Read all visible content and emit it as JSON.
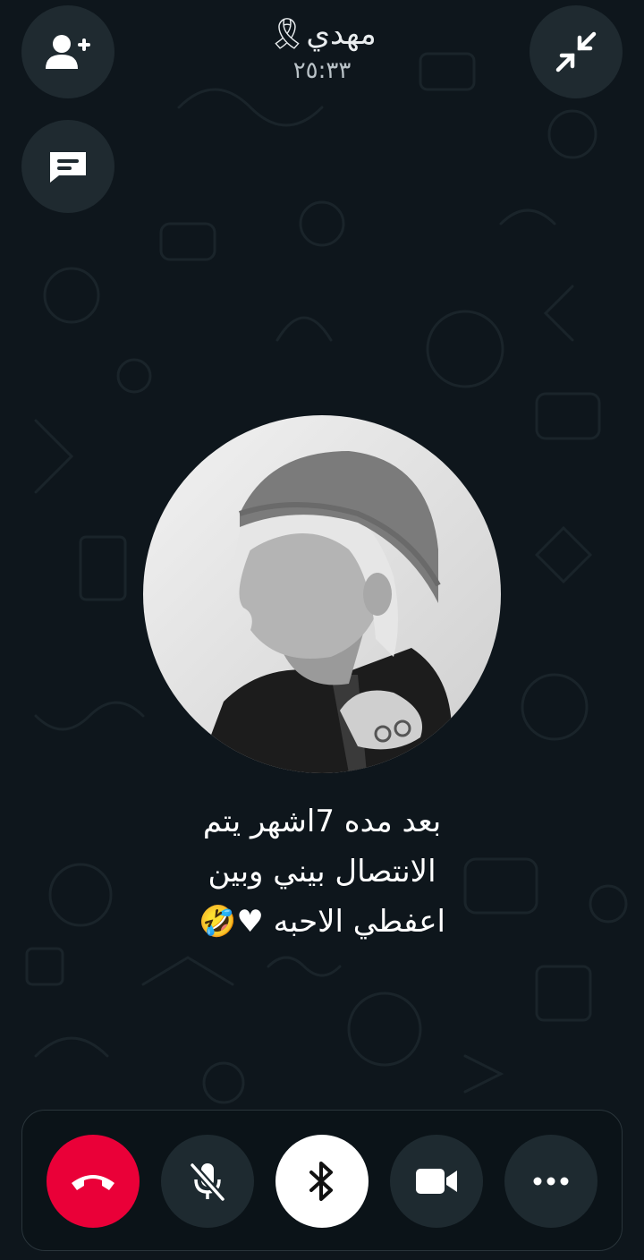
{
  "call": {
    "contact_name": "مهدي🎗",
    "timer": "٢٥:٣٣",
    "status_lines": [
      "بعد مده 7اشهر يتم",
      "الانتصال بيني وبين",
      "اعفطي الاحبه ♥🤣"
    ]
  },
  "buttons": {
    "add_participant": "person-add-icon",
    "message": "message-icon",
    "minimize": "minimize-arrows-icon",
    "end_call": "phone-hangup-icon",
    "mute": "mic-off-icon",
    "bluetooth": "bluetooth-icon",
    "video": "video-camera-icon",
    "more": "more-dots-icon"
  },
  "colors": {
    "background": "#0e161c",
    "button_bg": "#1e2a30",
    "end_call": "#ea0038",
    "bluetooth_active": "#ffffff",
    "text": "#e9edef"
  }
}
